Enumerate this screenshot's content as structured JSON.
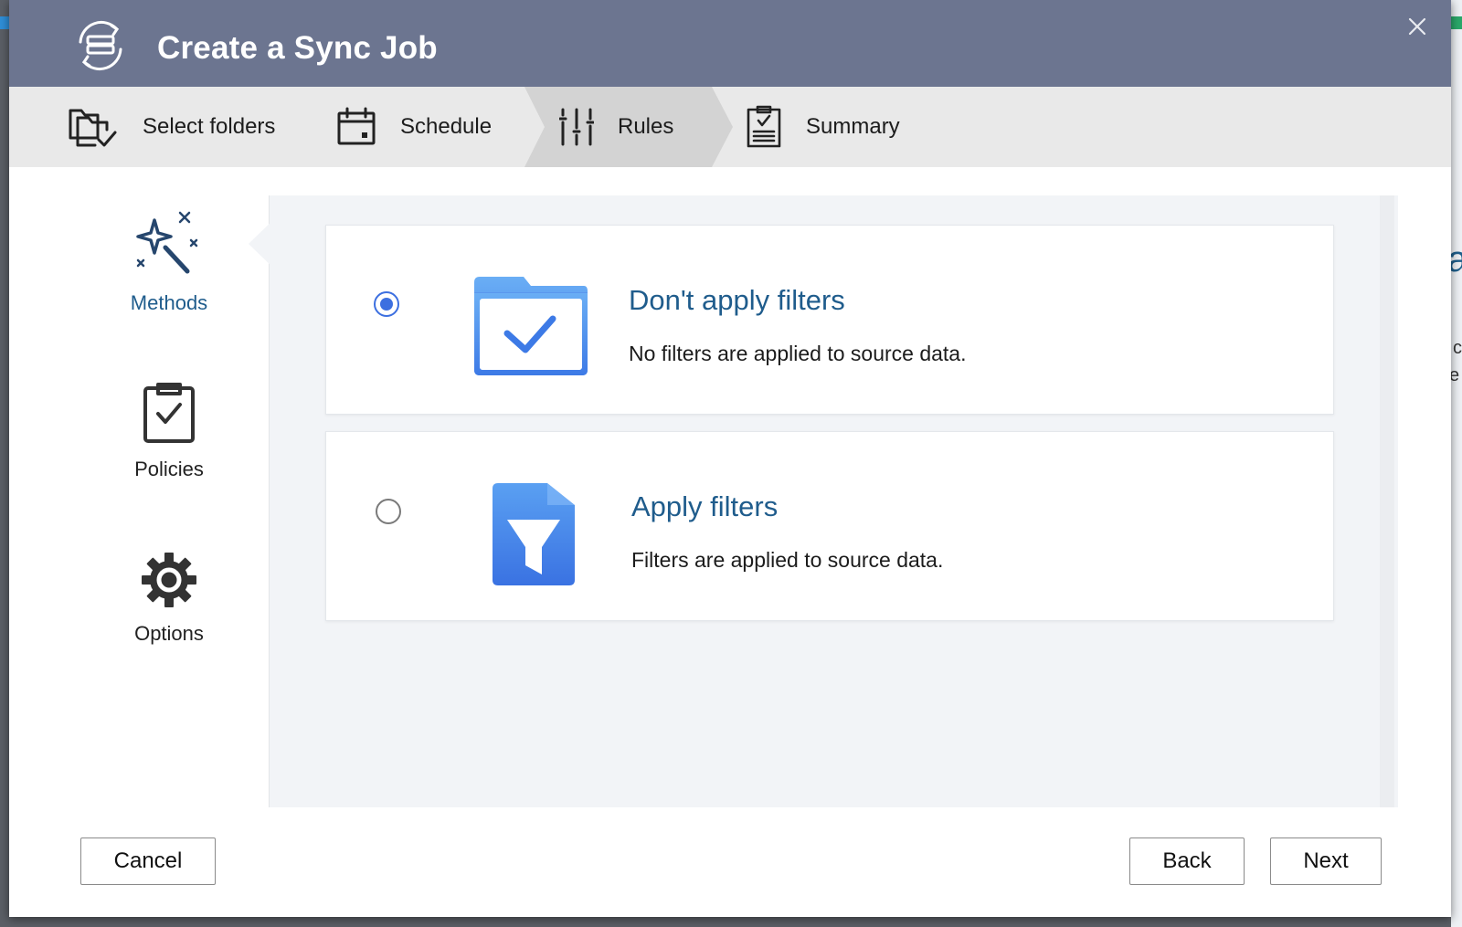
{
  "dialog": {
    "title": "Create a Sync Job",
    "close_icon": "close-icon",
    "title_icon": "sync-server-icon"
  },
  "steps": [
    {
      "label": "Select folders",
      "icon": "folder-check-icon",
      "active": false
    },
    {
      "label": "Schedule",
      "icon": "calendar-icon",
      "active": false
    },
    {
      "label": "Rules",
      "icon": "sliders-icon",
      "active": true
    },
    {
      "label": "Summary",
      "icon": "clipboard-list-icon",
      "active": false
    }
  ],
  "sidenav": {
    "items": [
      {
        "label": "Methods",
        "icon": "magic-wand-icon",
        "active": true
      },
      {
        "label": "Policies",
        "icon": "clipboard-check-icon",
        "active": false
      },
      {
        "label": "Options",
        "icon": "gear-icon",
        "active": false
      }
    ]
  },
  "methods": {
    "options": [
      {
        "title": "Don't apply filters",
        "description": "No filters are applied to source data.",
        "icon": "folder-check-icon",
        "selected": true
      },
      {
        "title": "Apply filters",
        "description": "Filters are applied to source data.",
        "icon": "filter-file-icon",
        "selected": false
      }
    ]
  },
  "buttons": {
    "cancel": "Cancel",
    "back": "Back",
    "next": "Next"
  },
  "colors": {
    "titlebar": "#6c7590",
    "accent": "#1f5c8c",
    "radio": "#3c6fe0",
    "icon_blue": "#3d7ae6"
  }
}
